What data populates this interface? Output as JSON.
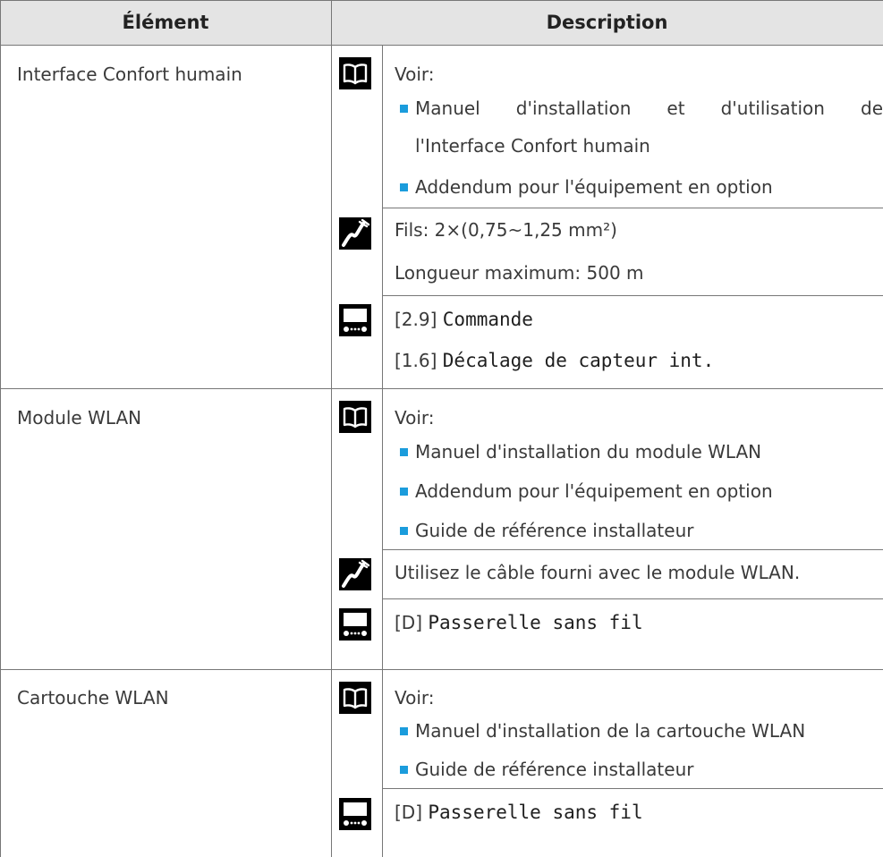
{
  "table": {
    "headers": {
      "element": "Élément",
      "description": "Description"
    },
    "rows": [
      {
        "element": "Interface Confort humain",
        "blocks": [
          {
            "icon": "book-icon",
            "lines": [
              "Voir:"
            ],
            "bullets": [
              "Manuel d'installation et d'utilisation de",
              "l'Interface Confort humain",
              "Addendum pour l'équipement en option"
            ]
          },
          {
            "icon": "wiring-icon",
            "lines": [
              "Fils: 2×(0,75~1,25 mm²)",
              "Longueur maximum: 500 m"
            ]
          },
          {
            "icon": "controller-icon",
            "settings": [
              {
                "ref": "[2.9]",
                "name": "Commande"
              },
              {
                "ref": "[1.6]",
                "name": "Décalage de capteur int."
              }
            ]
          }
        ]
      },
      {
        "element": "Module WLAN",
        "blocks": [
          {
            "icon": "book-icon",
            "lines": [
              "Voir:"
            ],
            "bullets": [
              "Manuel d'installation du module WLAN",
              "Addendum pour l'équipement en option",
              "Guide de référence installateur"
            ]
          },
          {
            "icon": "wiring-icon",
            "lines": [
              "Utilisez le câble fourni avec le module WLAN."
            ]
          },
          {
            "icon": "controller-icon",
            "settings": [
              {
                "ref": "[D]",
                "name": "Passerelle sans fil"
              }
            ]
          }
        ]
      },
      {
        "element": "Cartouche WLAN",
        "blocks": [
          {
            "icon": "book-icon",
            "lines": [
              "Voir:"
            ],
            "bullets": [
              "Manuel d'installation de la cartouche WLAN",
              "Guide de référence installateur"
            ]
          },
          {
            "icon": "controller-icon",
            "settings": [
              {
                "ref": "[D]",
                "name": "Passerelle sans fil"
              }
            ]
          }
        ]
      }
    ]
  },
  "colors": {
    "header_bg": "#e4e4e4",
    "bullet": "#1b9cdc",
    "rule": "#777777",
    "icon_bg": "#000000"
  }
}
